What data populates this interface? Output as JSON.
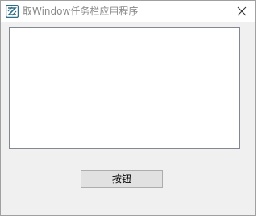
{
  "window": {
    "title": "取Window任务栏应用程序",
    "app_icon": "app-logo-icon",
    "close_icon": "close-icon"
  },
  "main": {
    "list_items": [],
    "button_label": "按钮"
  },
  "colors": {
    "title_text": "#8a8a8a",
    "window_bg": "#f0f0f0",
    "button_bg": "#e1e1e1",
    "icon_teal": "#2e6f88"
  }
}
